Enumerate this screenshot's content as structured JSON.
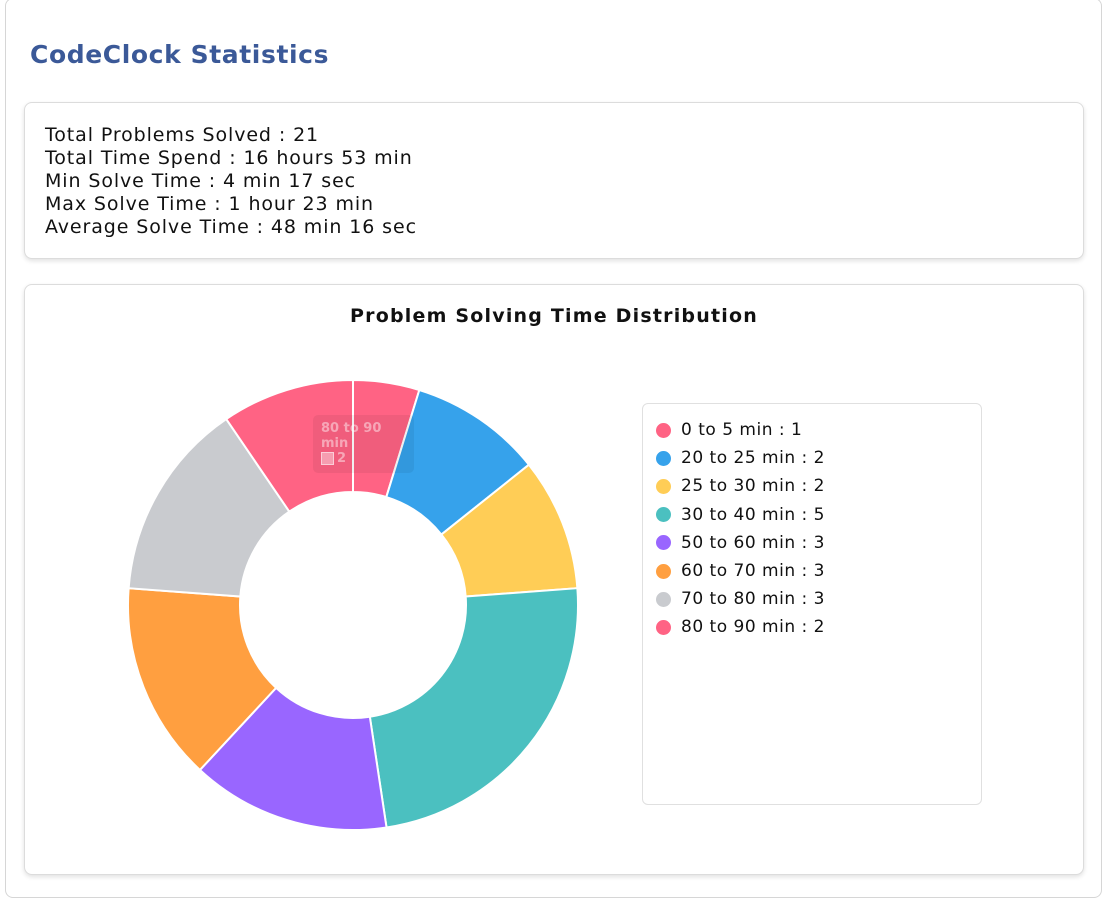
{
  "page": {
    "title": "CodeClock Statistics"
  },
  "stats": {
    "lines": [
      "Total Problems Solved : 21",
      "Total Time Spend : 16 hours 53 min",
      "Min Solve Time : 4 min 17 sec",
      "Max Solve Time : 1 hour 23 min",
      "Average Solve Time : 48 min 16 sec"
    ]
  },
  "tooltip": {
    "label": "80 to 90 min",
    "value": "2"
  },
  "chart_data": {
    "type": "pie",
    "style": "doughnut",
    "title": "Problem Solving Time Distribution",
    "legend_position": "right",
    "categories": [
      "0 to 5 min",
      "20 to 25 min",
      "25 to 30 min",
      "30 to 40 min",
      "50 to 60 min",
      "60 to 70 min",
      "70 to 80 min",
      "80 to 90 min"
    ],
    "values": [
      1,
      2,
      2,
      5,
      3,
      3,
      3,
      2
    ],
    "legend_labels": [
      "0 to 5 min : 1",
      "20 to 25 min : 2",
      "25 to 30 min : 2",
      "30 to 40 min : 5",
      "50 to 60 min : 3",
      "60 to 70 min : 3",
      "70 to 80 min : 3",
      "80 to 90 min : 2"
    ],
    "colors": [
      "#ff6384",
      "#36a2eb",
      "#ffcd56",
      "#4bc0c0",
      "#9966ff",
      "#ff9f40",
      "#c9cbcf",
      "#ff6384"
    ]
  }
}
